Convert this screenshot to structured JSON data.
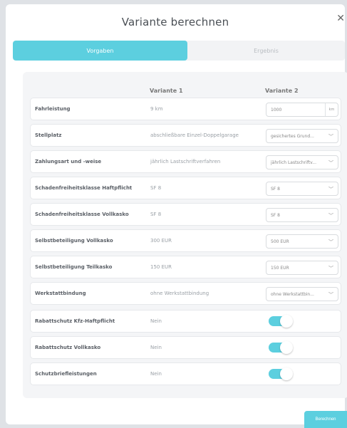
{
  "title": "Variante berechnen",
  "tabs": {
    "active": "Vorgaben",
    "inactive": "Ergebnis"
  },
  "columns": {
    "v1": "Variante 1",
    "v2": "Variante 2"
  },
  "rows": [
    {
      "label": "Fahrleistung",
      "v1": "9 km",
      "v2": "1000",
      "unit": "km",
      "type": "input"
    },
    {
      "label": "Stellplatz",
      "v1": "abschließbare Einzel-Doppelgarage",
      "v2": "gesichertes Grund...",
      "type": "select"
    },
    {
      "label": "Zahlungsart und -weise",
      "v1": "jährlich Lastschriftverfahren",
      "v2": "jährlich Lastschriftv...",
      "type": "select"
    },
    {
      "label": "Schadenfreiheitsklasse Haftpflicht",
      "v1": "SF 8",
      "v2": "SF 8",
      "type": "select"
    },
    {
      "label": "Schadenfreiheitsklasse Vollkasko",
      "v1": "SF 8",
      "v2": "SF 8",
      "type": "select"
    },
    {
      "label": "Selbstbeteiligung Vollkasko",
      "v1": "300 EUR",
      "v2": "500 EUR",
      "type": "select"
    },
    {
      "label": "Selbstbeteiligung Teilkasko",
      "v1": "150 EUR",
      "v2": "150 EUR",
      "type": "select"
    },
    {
      "label": "Werkstattbindung",
      "v1": "ohne Werkstattbindung",
      "v2": "ohne Werkstattbin...",
      "type": "select"
    },
    {
      "label": "Rabattschutz Kfz-Haftpflicht",
      "v1": "Nein",
      "type": "toggle"
    },
    {
      "label": "Rabattschutz Vollkasko",
      "v1": "Nein",
      "type": "toggle"
    },
    {
      "label": "Schutzbriefleistungen",
      "v1": "Nein",
      "type": "toggle"
    }
  ],
  "button": "Berechnen",
  "colors": {
    "accent": "#5ccfdf"
  }
}
